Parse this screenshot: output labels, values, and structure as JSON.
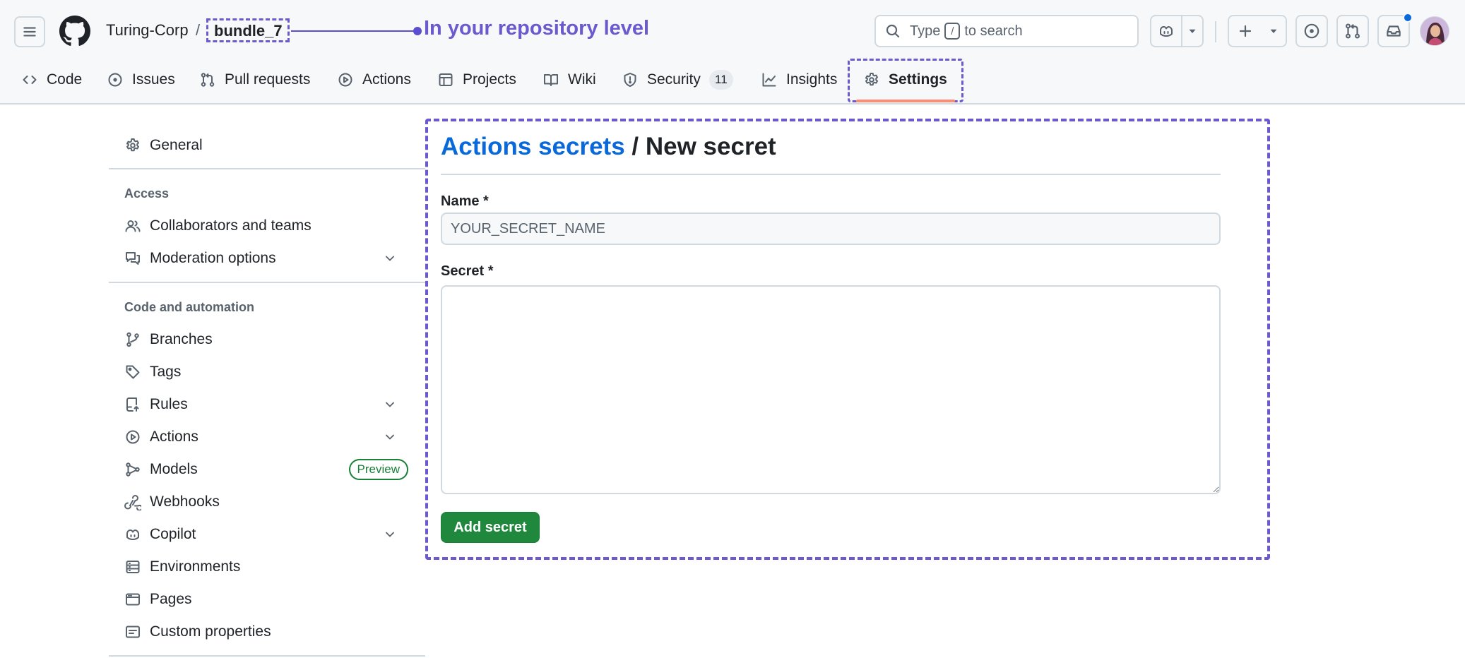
{
  "header": {
    "owner": "Turing-Corp",
    "separator": "/",
    "repo": "bundle_7",
    "annotation": "In your repository level",
    "search": {
      "prefix": "Type",
      "key": "/",
      "suffix": "to search"
    }
  },
  "nav": {
    "items": [
      {
        "label": "Code",
        "icon": "code-icon"
      },
      {
        "label": "Issues",
        "icon": "issue-opened-icon"
      },
      {
        "label": "Pull requests",
        "icon": "git-pull-request-icon"
      },
      {
        "label": "Actions",
        "icon": "play-icon"
      },
      {
        "label": "Projects",
        "icon": "table-icon"
      },
      {
        "label": "Wiki",
        "icon": "book-icon"
      },
      {
        "label": "Security",
        "icon": "shield-icon",
        "count": "11"
      },
      {
        "label": "Insights",
        "icon": "graph-icon"
      },
      {
        "label": "Settings",
        "icon": "gear-icon",
        "selected": true
      }
    ]
  },
  "sidebar": {
    "general": "General",
    "access_heading": "Access",
    "access": [
      {
        "label": "Collaborators and teams"
      },
      {
        "label": "Moderation options",
        "expandable": true
      }
    ],
    "code_heading": "Code and automation",
    "code": [
      {
        "label": "Branches"
      },
      {
        "label": "Tags"
      },
      {
        "label": "Rules",
        "expandable": true
      },
      {
        "label": "Actions",
        "expandable": true
      },
      {
        "label": "Models",
        "badge": "Preview"
      },
      {
        "label": "Webhooks"
      },
      {
        "label": "Copilot",
        "expandable": true
      },
      {
        "label": "Environments"
      },
      {
        "label": "Pages"
      },
      {
        "label": "Custom properties"
      }
    ]
  },
  "main": {
    "breadcrumb_link": "Actions secrets",
    "title_sep": " / ",
    "title": "New secret",
    "name_label": "Name *",
    "name_placeholder": "YOUR_SECRET_NAME",
    "secret_label": "Secret *",
    "secret_value": "",
    "submit_label": "Add secret"
  },
  "colors": {
    "annotation": "#6a5acd",
    "link": "#0969da",
    "primary_button": "#1f883d",
    "selected_tab_underline": "#fd8c73",
    "preview_badge": "#1a7f37"
  }
}
